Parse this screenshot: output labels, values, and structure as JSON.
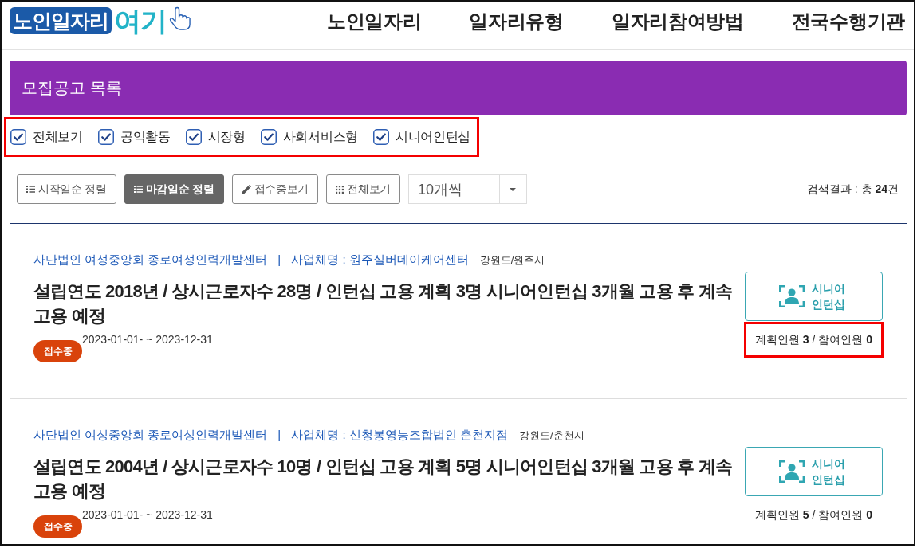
{
  "header": {
    "logo": {
      "text": "노인일자리",
      "accent": "여기"
    },
    "nav": [
      {
        "label": "노인일자리"
      },
      {
        "label": "일자리유형"
      },
      {
        "label": "일자리참여방법"
      },
      {
        "label": "전국수행기관"
      }
    ]
  },
  "banner": {
    "title": "모집공고 목록"
  },
  "filters": {
    "highlighted": true,
    "items": [
      {
        "label": "전체보기",
        "checked": true
      },
      {
        "label": "공익활동",
        "checked": true
      },
      {
        "label": "시장형",
        "checked": true
      },
      {
        "label": "사회서비스형",
        "checked": true
      },
      {
        "label": "시니어인턴십",
        "checked": true
      }
    ]
  },
  "toolbar": {
    "buttons": [
      {
        "label": "시작일순 정렬",
        "kind": "sort",
        "selected": false
      },
      {
        "label": "마감일순 정렬",
        "kind": "sort",
        "selected": true
      },
      {
        "label": "접수중보기",
        "kind": "receiving",
        "selected": false
      },
      {
        "label": "전체보기",
        "kind": "all",
        "selected": false
      }
    ],
    "page_size": {
      "value": "10개씩"
    },
    "result": "검색결과 : 총 **24**건"
  },
  "listings": [
    {
      "organization": "사단법인 여성중앙회 종로여성인력개발센터",
      "divider": "|",
      "business": "사업체명 : 원주실버데이케어센터",
      "region": "강원도/원주시",
      "title": "설립연도 2018년 / 상시근로자수 28명 / 인턴십 고용 계획 3명 시니어인턴십 3개월 고용 후 계속 고용 예정",
      "period": "2023-01-01- ~ 2023-12-31",
      "status": "접수중",
      "category": "시니어 인턴십",
      "count": "계획인원 **3** / 참여인원 **0**",
      "count_highlighted": true
    },
    {
      "organization": "사단법인 여성중앙회 종로여성인력개발센터",
      "divider": "|",
      "business": "사업체명 : 신청봉영농조합법인 춘천지점",
      "region": "강원도/춘천시",
      "title": "설립연도 2004년 / 상시근로자수 10명 / 인턴십 고용 계획 5명 시니어인턴십 3개월 고용 후 계속 고용 예정",
      "period": "2023-01-01- ~ 2023-12-31",
      "status": "접수중",
      "category": "시니어 인턴십",
      "count": "계획인원 **5** / 참여인원 **0**",
      "count_highlighted": false
    }
  ]
}
